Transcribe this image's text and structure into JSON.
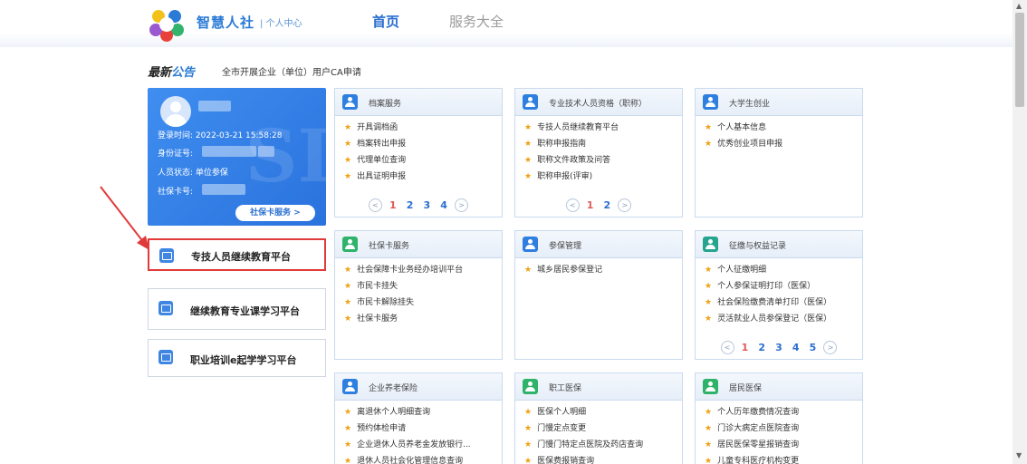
{
  "header": {
    "brand": "智慧人社",
    "sub_brand": "| 个人中心",
    "nav": {
      "home": "首页",
      "services": "服务大全"
    }
  },
  "notice": {
    "tag_a": "最新",
    "tag_b": "公告",
    "text": "全市开展企业（单位）用户CA申请"
  },
  "profile": {
    "login_time": "登录时间: 2022-03-21 15:58:28",
    "id_label": "身份证号:",
    "status": "人员状态: 单位参保",
    "card_label": "社保卡号:",
    "card_button": "社保卡服务 >"
  },
  "platforms": [
    {
      "label": "专技人员继续教育平台"
    },
    {
      "label": "继续教育专业课学习平台"
    },
    {
      "label": "职业培训e起学学习平台"
    }
  ],
  "boxes": {
    "archives": {
      "title": "档案服务",
      "items": [
        "开具调档函",
        "档案转出申报",
        "代理单位查询",
        "出具证明申报"
      ],
      "pages": [
        "1",
        "2",
        "3",
        "4"
      ]
    },
    "professional": {
      "title": "专业技术人员资格（职称）",
      "items": [
        "专技人员继续教育平台",
        "职称申报指南",
        "职称文件政策及问答",
        "职称申报(评审)"
      ],
      "pages": [
        "1",
        "2"
      ]
    },
    "college": {
      "title": "大学生创业",
      "items": [
        "个人基本信息",
        "优秀创业项目申报"
      ]
    },
    "sscard": {
      "title": "社保卡服务",
      "items": [
        "社会保障卡业务经办培训平台",
        "市民卡挂失",
        "市民卡解除挂失",
        "社保卡服务"
      ]
    },
    "insurance": {
      "title": "参保管理",
      "items": [
        "城乡居民参保登记"
      ]
    },
    "rights": {
      "title": "征缴与权益记录",
      "items": [
        "个人征缴明细",
        "个人参保证明打印（医保）",
        "社会保险缴费清单打印（医保）",
        "灵活就业人员参保登记（医保）"
      ],
      "pages": [
        "1",
        "2",
        "3",
        "4",
        "5"
      ]
    },
    "pension": {
      "title": "企业养老保险",
      "items": [
        "离退休个人明细查询",
        "预约体检申请",
        "企业退休人员养老金发放银行...",
        "退休人员社会化管理信息查询"
      ]
    },
    "staff_med": {
      "title": "职工医保",
      "items": [
        "医保个人明细",
        "门慢定点变更",
        "门慢门特定点医院及药店查询",
        "医保费报销查询"
      ]
    },
    "resident_med": {
      "title": "居民医保",
      "items": [
        "个人历年缴费情况查询",
        "门诊大病定点医院查询",
        "居民医保零星报销查询",
        "儿童专科医疗机构变更"
      ]
    }
  },
  "pager_arrows": {
    "prev": "<",
    "next": ">"
  },
  "colors": {
    "accent": "#2a6fd1",
    "highlight": "#e03a3a",
    "star": "#f0a010"
  }
}
